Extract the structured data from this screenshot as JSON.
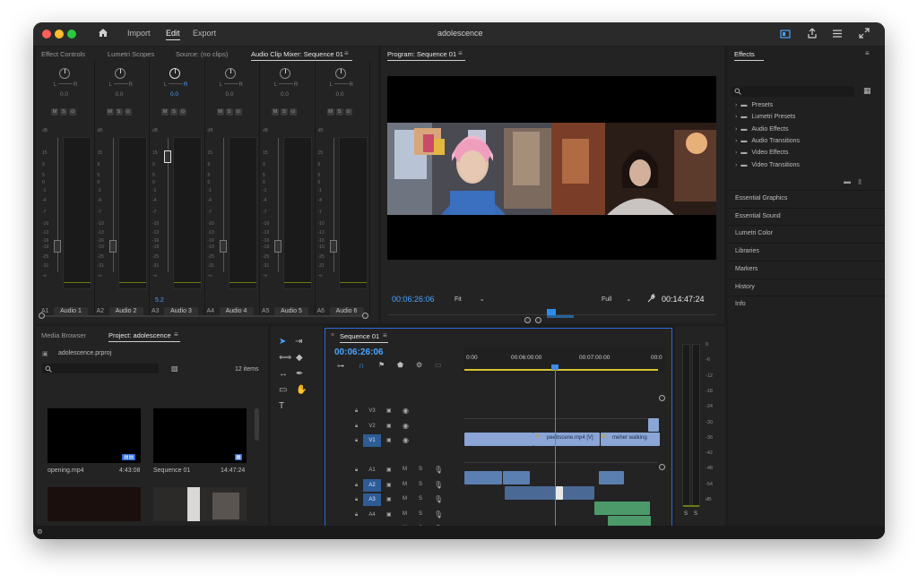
{
  "window": {
    "title": "adolescence",
    "workspaces": [
      "Import",
      "Edit",
      "Export"
    ],
    "active_workspace": "Edit"
  },
  "colors": {
    "accent": "#2d8ceb",
    "timecode": "#4aa3ff",
    "playhead": "#3f8ce8",
    "video_clip": "#8aa5d6",
    "audio_clip": "#5a7fb0",
    "green_audio_clip": "#4c9a6a",
    "meter_level": "#6d7a12"
  },
  "effect_controls_tabs": [
    "Effect Controls",
    "Lumetri Scopes",
    "Source: (no clips)",
    "Audio Clip Mixer: Sequence 01"
  ],
  "audio_mixer": {
    "channels": [
      {
        "id": "A1",
        "name": "Audio 1",
        "value": "0.0",
        "lr_l": "L",
        "lr_r": "R"
      },
      {
        "id": "A2",
        "name": "Audio 2",
        "value": "0.0",
        "lr_l": "L",
        "lr_r": "R"
      },
      {
        "id": "A3",
        "name": "Audio 3",
        "value": "0.0",
        "lr_l": "L",
        "lr_r": "R",
        "fader_value": "5.2",
        "active": true
      },
      {
        "id": "A4",
        "name": "Audio 4",
        "value": "0.0",
        "lr_l": "L",
        "lr_r": "R"
      },
      {
        "id": "A5",
        "name": "Audio 5",
        "value": "0.0",
        "lr_l": "L",
        "lr_r": "R"
      },
      {
        "id": "A6",
        "name": "Audio 6",
        "value": "0.0",
        "lr_l": "L",
        "lr_r": "R"
      }
    ],
    "ms_buttons": [
      "M",
      "S",
      "⊙"
    ],
    "db_label": "dB",
    "db_scale": [
      "15",
      "9",
      "5",
      "0",
      "-1",
      "-4",
      "-7",
      "-10",
      "-13",
      "-16",
      "-19",
      "-25",
      "-31",
      "-∞"
    ]
  },
  "program_monitor": {
    "title": "Program: Sequence 01",
    "current_timecode": "00:06:26:06",
    "fit": "Fit",
    "quality": "Full",
    "duration": "00:14:47:24"
  },
  "effects_panel": {
    "title": "Effects",
    "folders": [
      "Presets",
      "Lumetri Presets",
      "Audio Effects",
      "Audio Transitions",
      "Video Effects",
      "Video Transitions"
    ],
    "sections": [
      "Essential Graphics",
      "Essential Sound",
      "Lumetri Color",
      "Libraries",
      "Markers",
      "History",
      "Info"
    ]
  },
  "project_panel": {
    "tabs": [
      "Media Browser",
      "Project: adolescence"
    ],
    "file": "adolescence.prproj",
    "item_count": "12 items",
    "items": [
      {
        "name": "opening.mp4",
        "duration": "4:43:08"
      },
      {
        "name": "Sequence 01",
        "duration": "14:47:24"
      }
    ]
  },
  "timeline": {
    "title": "Sequence 01",
    "timecode": "00:06:26:06",
    "ruler": [
      "0:00",
      "00:06:00:00",
      "00:07:00:00",
      "00:0"
    ],
    "video_tracks": [
      "V3",
      "V2",
      "V1"
    ],
    "audio_tracks": [
      "A1",
      "A2",
      "A3",
      "A4",
      "A5"
    ],
    "clips": {
      "clip1": "peebscene.mp4 [V]",
      "clip2": "meher walking"
    },
    "track_buttons": {
      "m": "M",
      "s": "S"
    }
  },
  "audio_meter": {
    "scale": [
      "0",
      "-6",
      "-12",
      "-18",
      "-24",
      "-30",
      "-36",
      "-42",
      "-48",
      "-54",
      "dB"
    ],
    "solo_labels": [
      "S",
      "S"
    ]
  }
}
